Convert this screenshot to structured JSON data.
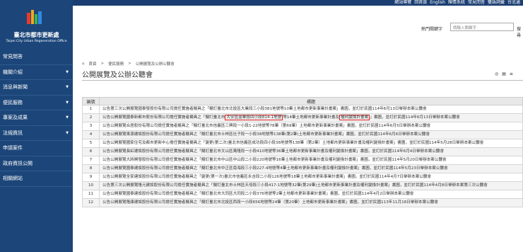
{
  "topbar": {
    "links": [
      "網站導覽",
      "回首頁",
      "English",
      "陳情系統",
      "常見問答",
      "雙語詞彙",
      "台北通"
    ]
  },
  "logo": {
    "name_cn": "臺北市都市更新處",
    "name_en": "Taipei City Urban Regeneration Office",
    "brand": "TAIPEI"
  },
  "sidebar": {
    "items": [
      {
        "label": "常見問答",
        "caret": false
      },
      {
        "label": "機關介紹",
        "caret": true
      },
      {
        "label": "消息與新聞",
        "caret": true
      },
      {
        "label": "便民服務",
        "caret": true
      },
      {
        "label": "專案及成果",
        "caret": true
      },
      {
        "label": "法規資訊",
        "caret": true
      },
      {
        "label": "申請案件",
        "caret": false
      },
      {
        "label": "政府資訊公開",
        "caret": false
      },
      {
        "label": "相關網站",
        "caret": false
      }
    ]
  },
  "search": {
    "label": "熱門關鍵字",
    "placeholder": "請輸入關鍵字",
    "button": "搜尋"
  },
  "breadcrumb": {
    "home": "首頁",
    "sep": ">",
    "level1": "便民服務",
    "level2": "公開展覽及公辦公聽會"
  },
  "page": {
    "title": "公開展覽及公辦公聽會"
  },
  "table": {
    "headers": [
      "編號",
      "標題"
    ],
    "rows": [
      {
        "num": "1",
        "title": "公告第三次公開展覽國泰發股份有限公司擔任實施者擬具之「擬訂臺北市北投區大業段三小段381地號等10筆土地都市更新事業計畫案」書圖，並訂於民國114年6月13日舉辦本案公聽會"
      },
      {
        "num": "2",
        "title_pre": "公告公開展覽國泰新都市股份有限公司擔任實施者擬具之「擬訂臺北市",
        "hl1": "大安區金華段四小段814-1地號",
        "title_mid": "等14筆土地都市更新事業計畫及",
        "hl2": "權利變換計畫案",
        "title_post": "」書圖，並訂於民國114年6月13日舉辦本案公聽會"
      },
      {
        "num": "3",
        "title": "公告公開展覽合居股份有限公司擔任實施者擬具之「擬訂臺北市信義區三興段一小段1-22地號等78筆（第69筆）土地都市更新事業計畫案」書圖，並訂於民國114年6月5日舉辦本案公聽會"
      },
      {
        "num": "4",
        "title": "公告公開展覽東源建設股份有限公司擔任實施者擬具之「擬訂臺北市士林區社子段一小段38地號等138筆(第2筆)土地都市更新事業計畫案」書圖，並訂於民國114年6月6日舉辦本案公聽會"
      },
      {
        "num": "5",
        "title": "公告公開展覽國家住宅及都市更新中心擔任實施者擬具之「變更(第二次)臺北市信義區成功段四小段38地號等138筆（第2筆）土地都市更新事業計畫及權利變換計畫案」書圖，並訂於民國114年5月28日舉辦本案公聽會"
      },
      {
        "num": "6",
        "title": "公告公開展覽長虹建設股份有限公司擔任實施者擬具之「擬訂臺北市文山區萬隆段一小段410地號等36筆土地都市更新事業計畫及權利變換計畫案」書圖，並訂於民國114年6月4日舉辦本案公聽會"
      },
      {
        "num": "7",
        "title": "公告公開展覽大將開發股份有限公司擔任實施者擬具之「擬訂臺北市中山區中山段二小段220地號等16筆土地都市更新事業計畫及權利變換計畫案」書圖，並訂於民國114年5月20日舉辦本案公聽會"
      },
      {
        "num": "8",
        "title": "公告公開展覽國泰建設股份有限公司擔任實施者擬具之「擬訂臺北市中正區南海段三小段227-4地號等4筆土地都市更新事業計畫及權利變換計畫案」書圖，並訂於民國114年5月23日舉辦本案公聽會"
      },
      {
        "num": "9",
        "title": "公告公開展覽全家建設股份有限公司擔任實施者擬具之「變更(第一次)臺北市信義區永吉段二小段126地號等18筆土地都市更新事業計畫案」書圖，並訂於民國114年4月7日舉辦本案公聽會"
      },
      {
        "num": "10",
        "title": "公告第三次公開展覽隆元建設股份有限公司擔任實施者擬具之「擬訂臺北市士林區天母段三小段417-1地號等32筆(第29筆)土地都市更新事業計畫及權利變換計畫案」書圖，並訂於民國114年4月8日舉辦本案第三次公聽會"
      },
      {
        "num": "11",
        "title": "公告公開展覽國泰建設股份有限公司擔任實施者擬具之「擬訂臺北市大同區大同段二小段376地號等2筆土地都市更新事業計畫案」書圖，並訂於民國114年4月2日舉辦本案公聽會"
      },
      {
        "num": "12",
        "title": "公告公開展覽隆康建設股份有限公司擔任實施者擬具之「擬訂臺北市北投區西段一小段656地號等24筆（第20筆）土地都市更新事業計畫案」書圖，並訂於民國113年11月18日舉辦本案公聽會"
      }
    ]
  },
  "colors": {
    "navy": "#1c4679",
    "highlight": "#e02020",
    "header_bg": "#e8e8e8"
  }
}
